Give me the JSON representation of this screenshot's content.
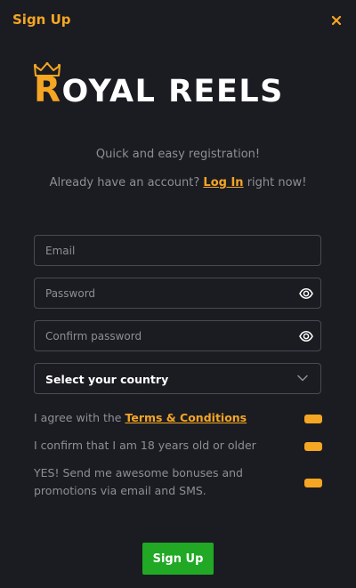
{
  "header": {
    "title": "Sign Up",
    "close_icon": "close-icon"
  },
  "logo": {
    "first_letter": "R",
    "rest": "OYAL REELS",
    "crown_icon": "crown-icon"
  },
  "intro": {
    "tagline": "Quick and easy registration!",
    "login_prefix": "Already have an account?",
    "login_link": "Log In",
    "login_suffix": "right now!"
  },
  "form": {
    "email": {
      "placeholder": "Email",
      "value": ""
    },
    "password": {
      "placeholder": "Password",
      "value": ""
    },
    "confirm_password": {
      "placeholder": "Confirm password",
      "value": ""
    },
    "country": {
      "selected": "Select your country"
    }
  },
  "checks": {
    "terms_prefix": "I agree with the",
    "terms_link": "Terms & Conditions",
    "age": "I confirm that I am 18 years old or older",
    "promo": "YES! Send me awesome bonuses and promotions via email and SMS."
  },
  "submit": {
    "label": "Sign Up"
  },
  "colors": {
    "accent": "#f5a623",
    "background": "#1b1c22",
    "submit": "#21a825"
  }
}
